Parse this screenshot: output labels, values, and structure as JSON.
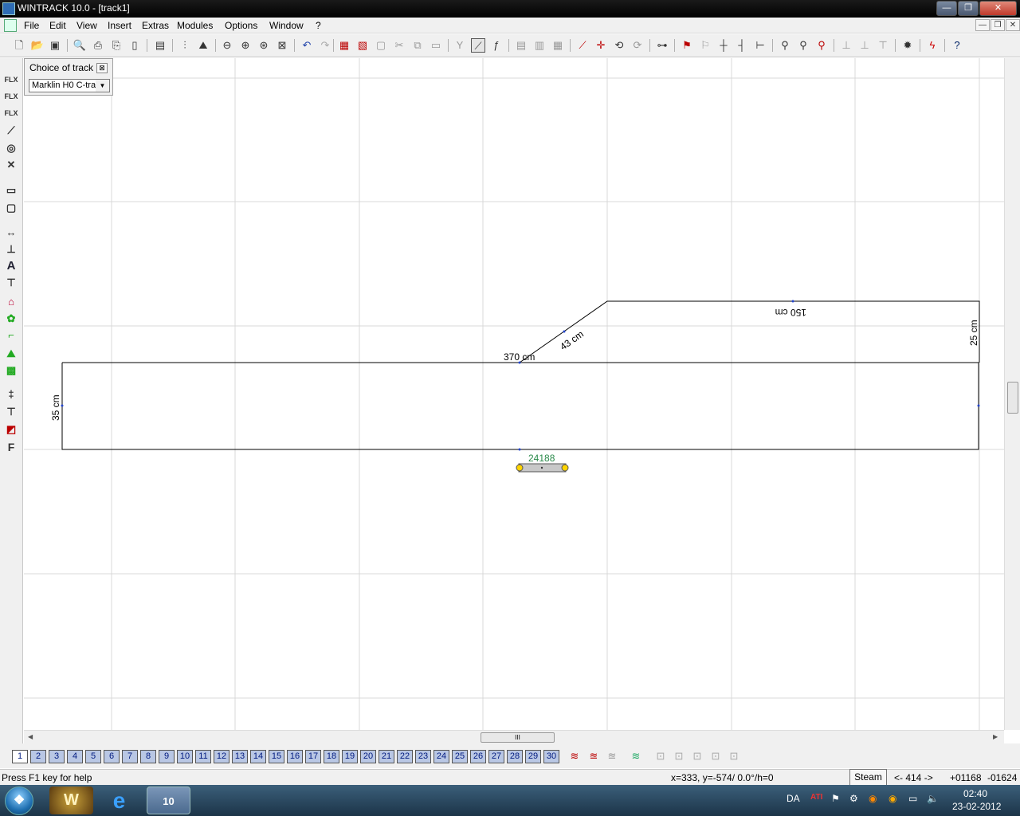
{
  "window": {
    "title": "WINTRACK 10.0 - [track1]",
    "caption_buttons": {
      "minimize": "—",
      "maximize": "❐",
      "close": "✕"
    }
  },
  "menu": [
    "File",
    "Edit",
    "View",
    "Insert",
    "Extras",
    "Modules",
    "Options",
    "Window",
    "?"
  ],
  "mdi_buttons": {
    "minimize": "—",
    "restore": "❐",
    "close": "✕"
  },
  "toolbar_icons": [
    "new-file-icon",
    "open-folder-icon",
    "save-icon",
    "print-preview-icon",
    "print-icon",
    "print-setup-icon",
    "page-icon",
    "export-icon",
    "track-properties-icon",
    "landscape-icon",
    "zoom-out-icon",
    "zoom-in-icon",
    "zoom-fit-icon",
    "zoom-window-icon",
    "undo-icon",
    "redo-icon",
    "delete-icon",
    "cut-element-icon",
    "duplicate-icon",
    "cut-icon",
    "copy-icon",
    "paste-icon",
    "y-switch-icon",
    "curve-track-icon",
    "flex-track-icon",
    "group-icon",
    "ungroup-icon",
    "merge-icon",
    "measure-icon",
    "center-icon",
    "rotate-icon",
    "rotate-180-icon",
    "connect-icon",
    "signal-icon",
    "signal-disabled-icon",
    "split-icon",
    "joint-icon",
    "gap-icon",
    "pin-icon",
    "pin2-icon",
    "pin3-icon",
    "align-icon",
    "align2-icon",
    "fit-icon",
    "pen-icon",
    "help-cursor-icon"
  ],
  "left_toolbar_icons": [
    "flex-track-icon",
    "flex-track-2-icon",
    "flex-track-3-icon",
    "ramp-icon",
    "turntable-icon",
    "crossing-icon",
    "platform-icon",
    "building-icon",
    "dimension-icon",
    "height-icon",
    "text-icon",
    "marker-icon",
    "house-icon",
    "tree-icon",
    "stairs-icon",
    "terrain-icon",
    "landscape-edit-icon",
    "vertical-icon",
    "step-icon",
    "wedge-icon",
    "layer-icon"
  ],
  "choice_panel": {
    "label": "Choice of track",
    "close": "⊠",
    "selected": "Marklin H0 C-tra"
  },
  "drawing": {
    "dim_370": "370 cm",
    "dim_43": "43 cm",
    "dim_150": "150 cm",
    "dim_25": "25 cm",
    "dim_35": "35 cm",
    "track_label": "24188"
  },
  "hscroll_thumb": "III",
  "layers": [
    "1",
    "2",
    "3",
    "4",
    "5",
    "6",
    "7",
    "8",
    "9",
    "10",
    "11",
    "12",
    "13",
    "14",
    "15",
    "16",
    "17",
    "18",
    "19",
    "20",
    "21",
    "22",
    "23",
    "24",
    "25",
    "26",
    "27",
    "28",
    "29",
    "30"
  ],
  "status": {
    "help": "Press F1 key for help",
    "coords": "x=333, y=-574/ 0.0°/h=0",
    "steam": "Steam",
    "nav": "<- 414 ->",
    "val1": "+01168",
    "val2": "-01624"
  },
  "taskbar": {
    "apps": [
      "wow-icon",
      "internet-explorer-icon",
      "wintrack-icon"
    ],
    "wintrack_badge": "10",
    "lang": "DA",
    "time": "02:40",
    "date": "23-02-2012"
  }
}
